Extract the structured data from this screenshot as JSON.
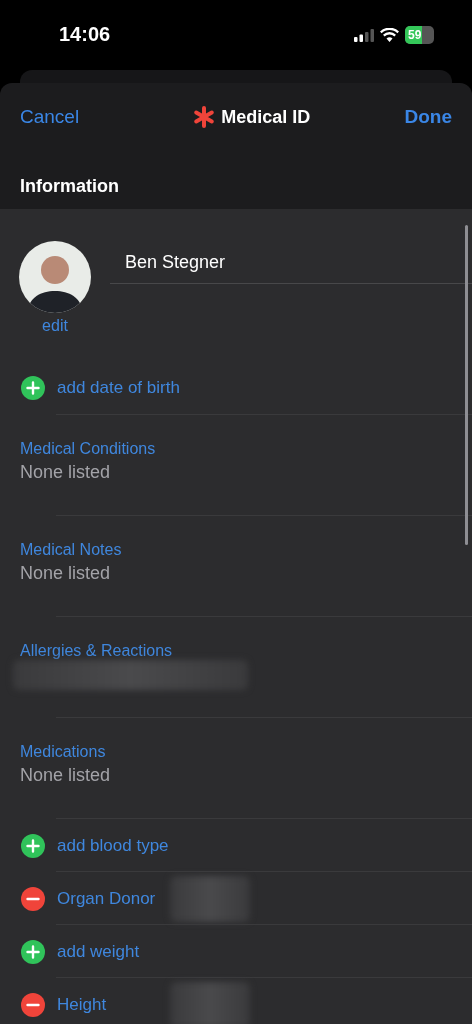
{
  "status_bar": {
    "time": "14:06",
    "battery": "59"
  },
  "nav": {
    "cancel": "Cancel",
    "title": "Medical ID",
    "done": "Done"
  },
  "section_header": "Information",
  "profile": {
    "name": "Ben Stegner",
    "edit": "edit"
  },
  "rows": [
    {
      "kind": "add",
      "label": "add date of birth",
      "redacted": false
    },
    {
      "kind": "field",
      "label": "Medical Conditions",
      "value": "None listed",
      "redacted": false
    },
    {
      "kind": "field",
      "label": "Medical Notes",
      "value": "None listed",
      "redacted": false
    },
    {
      "kind": "field",
      "label": "Allergies & Reactions",
      "redacted": true
    },
    {
      "kind": "field",
      "label": "Medications",
      "value": "None listed",
      "redacted": false
    },
    {
      "kind": "add",
      "label": "add blood type",
      "redacted": false
    },
    {
      "kind": "remove",
      "label": "Organ Donor",
      "redacted": true
    },
    {
      "kind": "add",
      "label": "add weight",
      "redacted": false
    },
    {
      "kind": "remove",
      "label": "Height",
      "redacted": true
    }
  ]
}
